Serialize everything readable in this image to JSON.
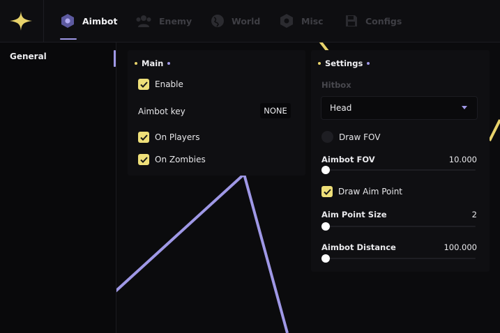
{
  "colors": {
    "accent": "#9f98e6",
    "check": "#eedf79",
    "yellow": "#e8d36b",
    "background": "#0b0b0d",
    "panel": "#0f0f12"
  },
  "topbar": {
    "logo_icon": "sparkle-star-icon",
    "tabs": [
      {
        "label": "Aimbot",
        "icon": "hexagon-icon",
        "active": true
      },
      {
        "label": "Enemy",
        "icon": "users-icon",
        "active": false
      },
      {
        "label": "World",
        "icon": "globe-icon",
        "active": false
      },
      {
        "label": "Misc",
        "icon": "gear-icon",
        "active": false
      },
      {
        "label": "Configs",
        "icon": "save-icon",
        "active": false
      }
    ]
  },
  "sidebar": {
    "items": [
      {
        "label": "General",
        "active": true
      }
    ]
  },
  "main_panel": {
    "title": "Main",
    "enable_label": "Enable",
    "enable_checked": true,
    "aimbot_key_label": "Aimbot key",
    "aimbot_key_value": "NONE",
    "on_players_label": "On Players",
    "on_players_checked": true,
    "on_zombies_label": "On Zombies",
    "on_zombies_checked": true
  },
  "settings_panel": {
    "title": "Settings",
    "hitbox_label": "Hitbox",
    "hitbox_value": "Head",
    "draw_fov_label": "Draw FOV",
    "draw_fov_checked": false,
    "aimbot_fov": {
      "label": "Aimbot FOV",
      "value": "10.000",
      "level": 0
    },
    "draw_aim_point_label": "Draw Aim Point",
    "draw_aim_point_checked": true,
    "aim_point_size": {
      "label": "Aim Point Size",
      "value": "2",
      "level": 0
    },
    "aimbot_distance": {
      "label": "Aimbot Distance",
      "value": "100.000",
      "level": 0
    }
  }
}
